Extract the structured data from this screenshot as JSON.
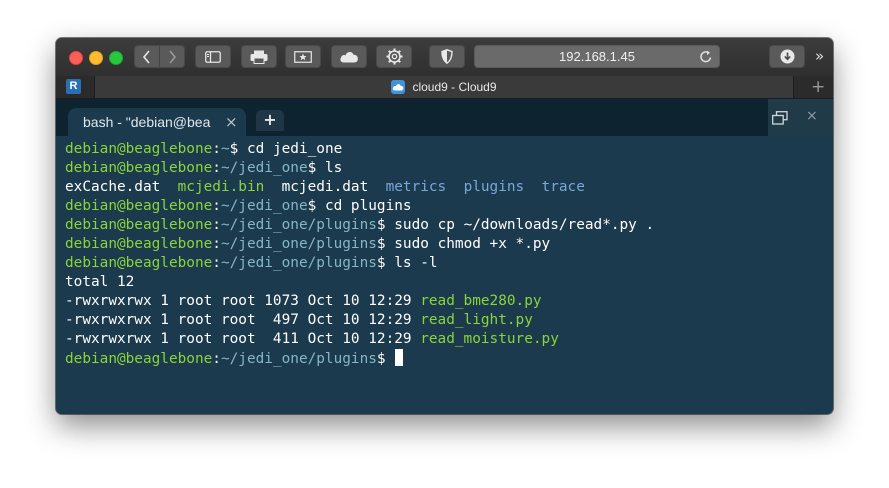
{
  "browser": {
    "url": "192.168.1.45",
    "tab_title": "cloud9 - Cloud9",
    "favicon_letter": "R",
    "new_tab_symbol": "+",
    "more_symbol": "»"
  },
  "ide": {
    "tab_label": "bash - \"debian@bea",
    "tab_close_symbol": "×",
    "add_tab_symbol": "+",
    "panel_close_symbol": "×"
  },
  "terminal": {
    "prompt_user": "debian@beaglebone",
    "lines": [
      {
        "path": "~",
        "cmd": " cd jedi_one"
      },
      {
        "path": "~/jedi_one",
        "cmd": " ls"
      },
      {
        "ls_entries": [
          "exCache.dat",
          "mcjedi.bin",
          "mcjedi.dat",
          "metrics",
          "plugins",
          "trace"
        ]
      },
      {
        "path": "~/jedi_one",
        "cmd": " cd plugins"
      },
      {
        "path": "~/jedi_one/plugins",
        "cmd": " sudo cp ~/downloads/read*.py ."
      },
      {
        "path": "~/jedi_one/plugins",
        "cmd": " sudo chmod +x *.py"
      },
      {
        "path": "~/jedi_one/plugins",
        "cmd": " ls -l"
      },
      {
        "text": "total 12"
      },
      {
        "meta": "-rwxrwxrwx 1 root root 1073 Oct 10 12:29 ",
        "file": "read_bme280.py"
      },
      {
        "meta": "-rwxrwxrwx 1 root root  497 Oct 10 12:29 ",
        "file": "read_light.py"
      },
      {
        "meta": "-rwxrwxrwx 1 root root  411 Oct 10 12:29 ",
        "file": "read_moisture.py"
      },
      {
        "path": "~/jedi_one/plugins",
        "cmd": " "
      }
    ]
  },
  "colors": {
    "terminal_bg": "#1b3a4d",
    "prompt_user": "#8cd43a",
    "prompt_path": "#86b5c7",
    "executable": "#8cd43a",
    "directory": "#7aa6da"
  },
  "icons": [
    "back-icon",
    "forward-icon",
    "sidebar-icon",
    "print-icon",
    "bookmark-icon",
    "cloud-icon",
    "gear-icon",
    "shield-icon",
    "reload-icon",
    "download-icon",
    "cloud9-icon",
    "restore-icon"
  ]
}
